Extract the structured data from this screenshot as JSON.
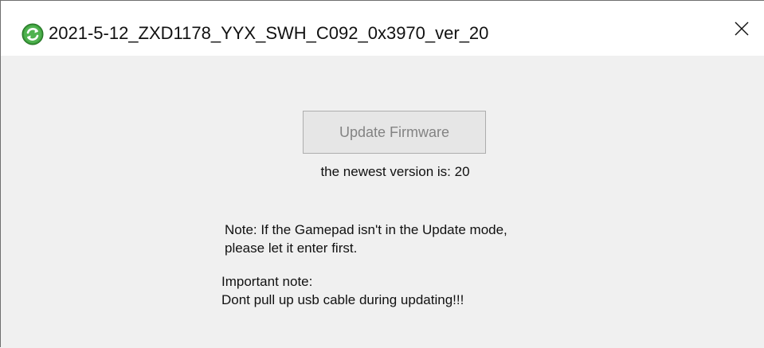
{
  "window": {
    "title": "2021-5-12_ZXD1178_YYX_SWH_C092_0x3970_ver_20",
    "icon": "refresh-icon",
    "close_icon": "close-icon",
    "accent_color": "#2e8b2e"
  },
  "main": {
    "update_button_label": "Update Firmware",
    "update_button_enabled": false,
    "version_text": "the newest version is: 20",
    "note_lines": [
      "Note: If the Gamepad isn't in the Update mode,",
      "please let it enter first."
    ],
    "important_lines": [
      "Important note:",
      "Dont pull up usb cable during updating!!!"
    ]
  }
}
